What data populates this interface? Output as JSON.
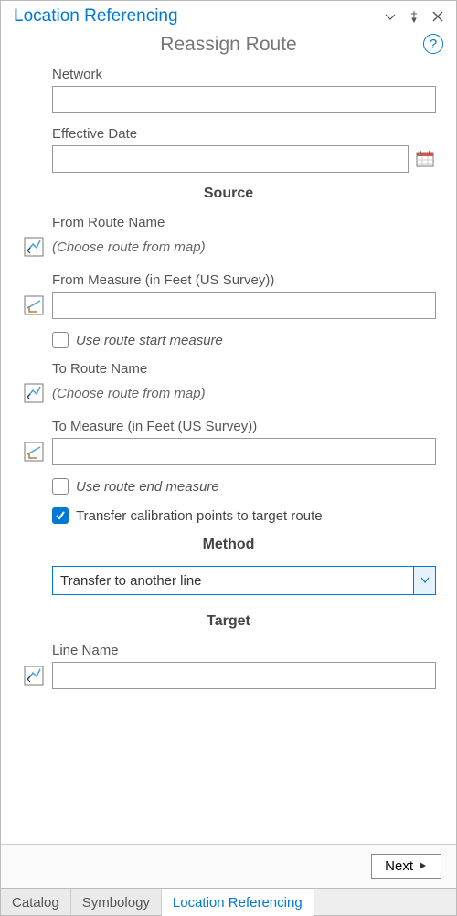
{
  "titlebar": {
    "title": "Location Referencing"
  },
  "subtitle": "Reassign Route",
  "labels": {
    "network": "Network",
    "effective_date": "Effective Date",
    "from_route_name": "From Route Name",
    "from_measure": "From Measure (in Feet (US Survey))",
    "to_route_name": "To Route Name",
    "to_measure": "To Measure (in Feet (US Survey))",
    "line_name": "Line Name"
  },
  "hints": {
    "choose_route": "(Choose route from map)"
  },
  "sections": {
    "source": "Source",
    "method": "Method",
    "target": "Target"
  },
  "checks": {
    "use_start": "Use route start measure",
    "use_end": "Use route end measure",
    "transfer_calib": "Transfer calibration points to target route"
  },
  "method": {
    "selected": "Transfer to another line"
  },
  "values": {
    "network": "",
    "effective_date": "",
    "from_measure": "",
    "to_measure": "",
    "line_name": ""
  },
  "buttons": {
    "next": "Next"
  },
  "tabs": [
    "Catalog",
    "Symbology",
    "Location Referencing"
  ],
  "active_tab": 2
}
